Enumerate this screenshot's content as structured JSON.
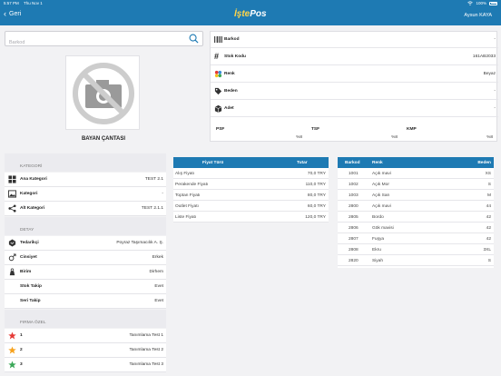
{
  "status_bar": {
    "time": "5:57 PM",
    "date": "Thu Nov 1",
    "battery": "100%"
  },
  "nav": {
    "back_label": "Geri",
    "logo_main": "İşte",
    "logo_accent": "Pos",
    "user": "Aysun KAYA"
  },
  "search": {
    "placeholder": "Barkod",
    "value": ""
  },
  "product": {
    "name": "BAYAN ÇANTASI"
  },
  "info": {
    "rows": [
      {
        "label": "Barkod",
        "value": "-",
        "icon": "barcode-icon"
      },
      {
        "label": "Stok Kodu",
        "value": "161AB2033",
        "icon": "hashtag-icon"
      },
      {
        "label": "Renk",
        "value": "Beyaz",
        "icon": "palette-icon"
      },
      {
        "label": "Beden",
        "value": "-",
        "icon": "tag-icon"
      },
      {
        "label": "Adet",
        "value": "-",
        "icon": "box-icon"
      }
    ],
    "prices": [
      {
        "label": "PSF",
        "value": "%8"
      },
      {
        "label": "TSF",
        "value": "%8"
      },
      {
        "label": "KMP",
        "value": "%8"
      }
    ]
  },
  "kategori": {
    "title": "KATEGORİ",
    "rows": [
      {
        "label": "Ana Kategori",
        "value": "TEST 2.1"
      },
      {
        "label": "Kategori",
        "value": "-"
      },
      {
        "label": "Alt Kategori",
        "value": "TEST 2.1.1"
      }
    ]
  },
  "detay": {
    "title": "DETAY",
    "rows": [
      {
        "label": "Tedarikçi",
        "value": "Poyraz Taşımacılık A. Ş."
      },
      {
        "label": "Cinsiyet",
        "value": "Erkek"
      },
      {
        "label": "Birim",
        "value": "Dirhem"
      },
      {
        "label": "Stok Takip",
        "value": "Evet"
      },
      {
        "label": "Seri Takip",
        "value": "Evet"
      }
    ]
  },
  "firma": {
    "title": "FIRMA ÖZEL",
    "rows": [
      {
        "label": "1",
        "value": "Tanımlama Test 1",
        "color": "#e53935"
      },
      {
        "label": "2",
        "value": "Tanımlama Test 2",
        "color": "#f6a11c"
      },
      {
        "label": "3",
        "value": "Tanımlama Test 3",
        "color": "#3aa757"
      }
    ]
  },
  "price_table": {
    "headers": [
      "Fiyat Türü",
      "Tutar"
    ],
    "rows": [
      [
        "Alış Fiyatı",
        "70,0 TRY"
      ],
      [
        "Perakende Fiyatı",
        "110,0 TRY"
      ],
      [
        "Toptan Fiyatı",
        "80,0 TRY"
      ],
      [
        "Outlet Fiyatı",
        "60,0 TRY"
      ],
      [
        "Liste Fiyatı",
        "120,0 TRY"
      ]
    ]
  },
  "stock_table": {
    "headers": [
      "Barkod",
      "Renk",
      "Beden"
    ],
    "rows": [
      [
        "1001",
        "Açık mavi",
        "XS"
      ],
      [
        "1002",
        "Açık Mor",
        "S"
      ],
      [
        "1003",
        "Açık Sarı",
        "M"
      ],
      [
        "2800",
        "Açık mavi",
        "44"
      ],
      [
        "2805",
        "Bordo",
        "42"
      ],
      [
        "2806",
        "Gök mavisi",
        "42"
      ],
      [
        "2807",
        "Fuşya",
        "42"
      ],
      [
        "2808",
        "Ekru",
        "3XL"
      ],
      [
        "2820",
        "Siyah",
        "S"
      ]
    ]
  }
}
